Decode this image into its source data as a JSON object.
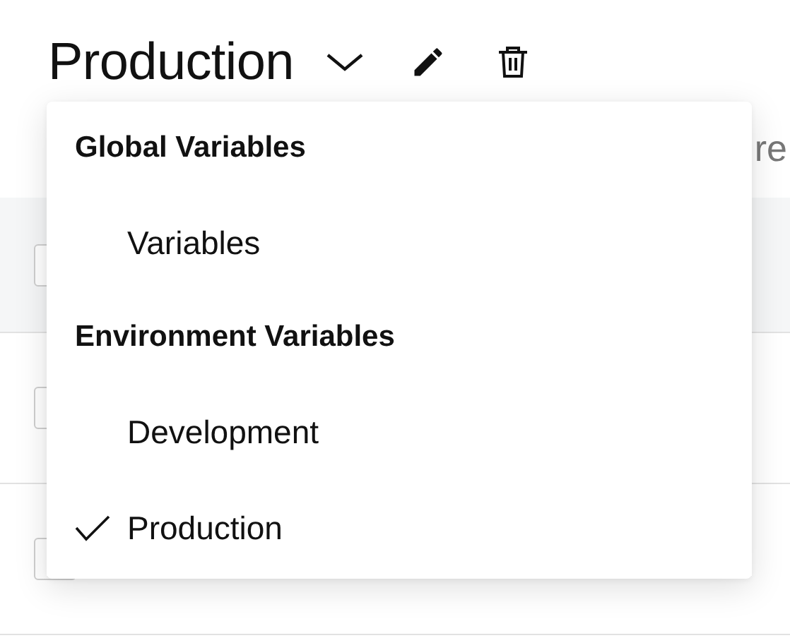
{
  "header": {
    "title": "Production"
  },
  "toolbar": {
    "text_fragment": "re"
  },
  "table": {
    "rows": [
      {
        "kind": "header",
        "checked": false
      },
      {
        "kind": "row",
        "checked": false
      },
      {
        "kind": "row",
        "checked": false
      }
    ]
  },
  "menu": {
    "groups": [
      {
        "heading": "Global Variables",
        "items": [
          {
            "label": "Variables",
            "selected": false
          }
        ]
      },
      {
        "heading": "Environment Variables",
        "items": [
          {
            "label": "Development",
            "selected": false
          },
          {
            "label": "Production",
            "selected": true
          }
        ]
      }
    ]
  }
}
